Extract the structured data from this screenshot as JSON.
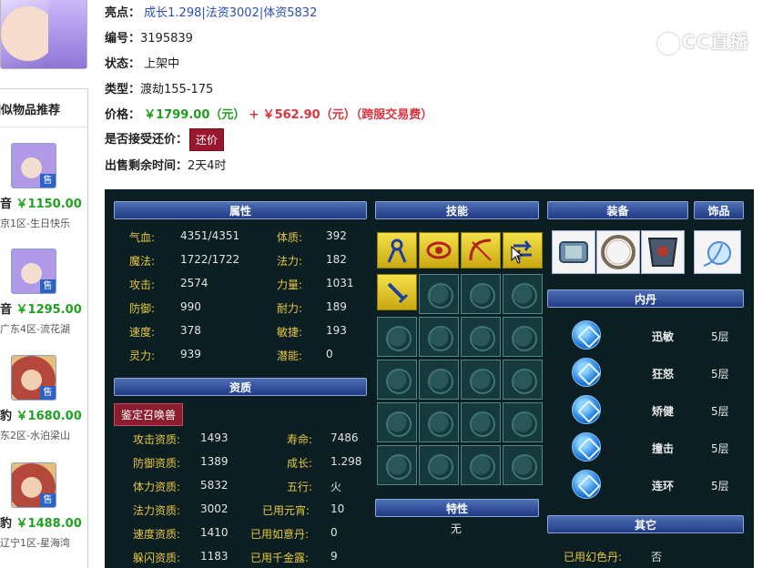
{
  "sidebar": {
    "title": "相似物品推荐",
    "items": [
      {
        "name_tail": "音",
        "price": "￥1150.00",
        "server": "京1区-生日快乐",
        "sale_badge": "售"
      },
      {
        "name_tail": "音",
        "price": "￥1295.00",
        "server": "广东4区-流花湖",
        "sale_badge": "售"
      },
      {
        "name_tail": "豹",
        "price": "￥1680.00",
        "server": "东2区-水泊梁山",
        "sale_badge": "售"
      },
      {
        "name_tail": "豹",
        "price": "￥1488.00",
        "server": "辽宁1区-星海湾",
        "sale_badge": "售"
      }
    ]
  },
  "info": {
    "highlight_label": "亮点：",
    "highlights": [
      "成长1.298",
      "法资3002",
      "体资5832"
    ],
    "highlight_sep": "|",
    "id_label": "编号：",
    "id_value": "3195839",
    "status_label": "状态：",
    "status_value": "上架中",
    "type_label": "类型：",
    "type_value": "渡劫155-175",
    "price_label": "价格：",
    "price_value": "￥1799.00（元）",
    "price_plus": "+",
    "fee_value": "￥562.90（元）（跨服交易费）",
    "haggle_label": "是否接受还价：",
    "haggle_button": "还价",
    "time_left_label": "出售剩余时间：",
    "time_left_value": "2天4时"
  },
  "watermark": "CC直播",
  "panel": {
    "headers": {
      "attributes": "属性",
      "skills": "技能",
      "equipment": "装备",
      "accessory": "饰品",
      "aptitude": "资质",
      "neidan": "内丹",
      "traits": "特性",
      "other": "其它"
    },
    "attributes": [
      {
        "k": "气血:",
        "v": "4351/4351",
        "k2": "体质:",
        "v2": "392"
      },
      {
        "k": "魔法:",
        "v": "1722/1722",
        "k2": "法力:",
        "v2": "182"
      },
      {
        "k": "攻击:",
        "v": "2574",
        "k2": "力量:",
        "v2": "1031"
      },
      {
        "k": "防御:",
        "v": "990",
        "k2": "耐力:",
        "v2": "189"
      },
      {
        "k": "速度:",
        "v": "378",
        "k2": "敏捷:",
        "v2": "193"
      },
      {
        "k": "灵力:",
        "v": "939",
        "k2": "潜能:",
        "v2": "0"
      }
    ],
    "appraise_button": "鉴定召唤兽",
    "aptitude": [
      {
        "k": "攻击资质:",
        "v": "1493",
        "k2": "寿命:",
        "v2": "7486"
      },
      {
        "k": "防御资质:",
        "v": "1389",
        "k2": "成长:",
        "v2": "1.298"
      },
      {
        "k": "体力资质:",
        "v": "5832",
        "k2": "五行:",
        "v2": "火"
      },
      {
        "k": "法力资质:",
        "v": "3002",
        "k2": "已用元宵:",
        "v2": "10"
      },
      {
        "k": "速度资质:",
        "v": "1410",
        "k2": "已用如意丹:",
        "v2": "0"
      },
      {
        "k": "躲闪资质:",
        "v": "1183",
        "k2": "已用千金露:",
        "v2": "9"
      }
    ],
    "traits_value": "无",
    "neidan": [
      {
        "name": "迅敏",
        "level": "5层",
        "icon": "neidan-speed-icon"
      },
      {
        "name": "狂怒",
        "level": "5层",
        "icon": "neidan-rage-icon"
      },
      {
        "name": "矫健",
        "level": "5层",
        "icon": "neidan-vigor-icon"
      },
      {
        "name": "撞击",
        "level": "5层",
        "icon": "neidan-impact-icon"
      },
      {
        "name": "连环",
        "level": "5层",
        "icon": "neidan-chain-icon"
      }
    ],
    "other": {
      "label": "已用幻色丹:",
      "value": "否"
    }
  }
}
